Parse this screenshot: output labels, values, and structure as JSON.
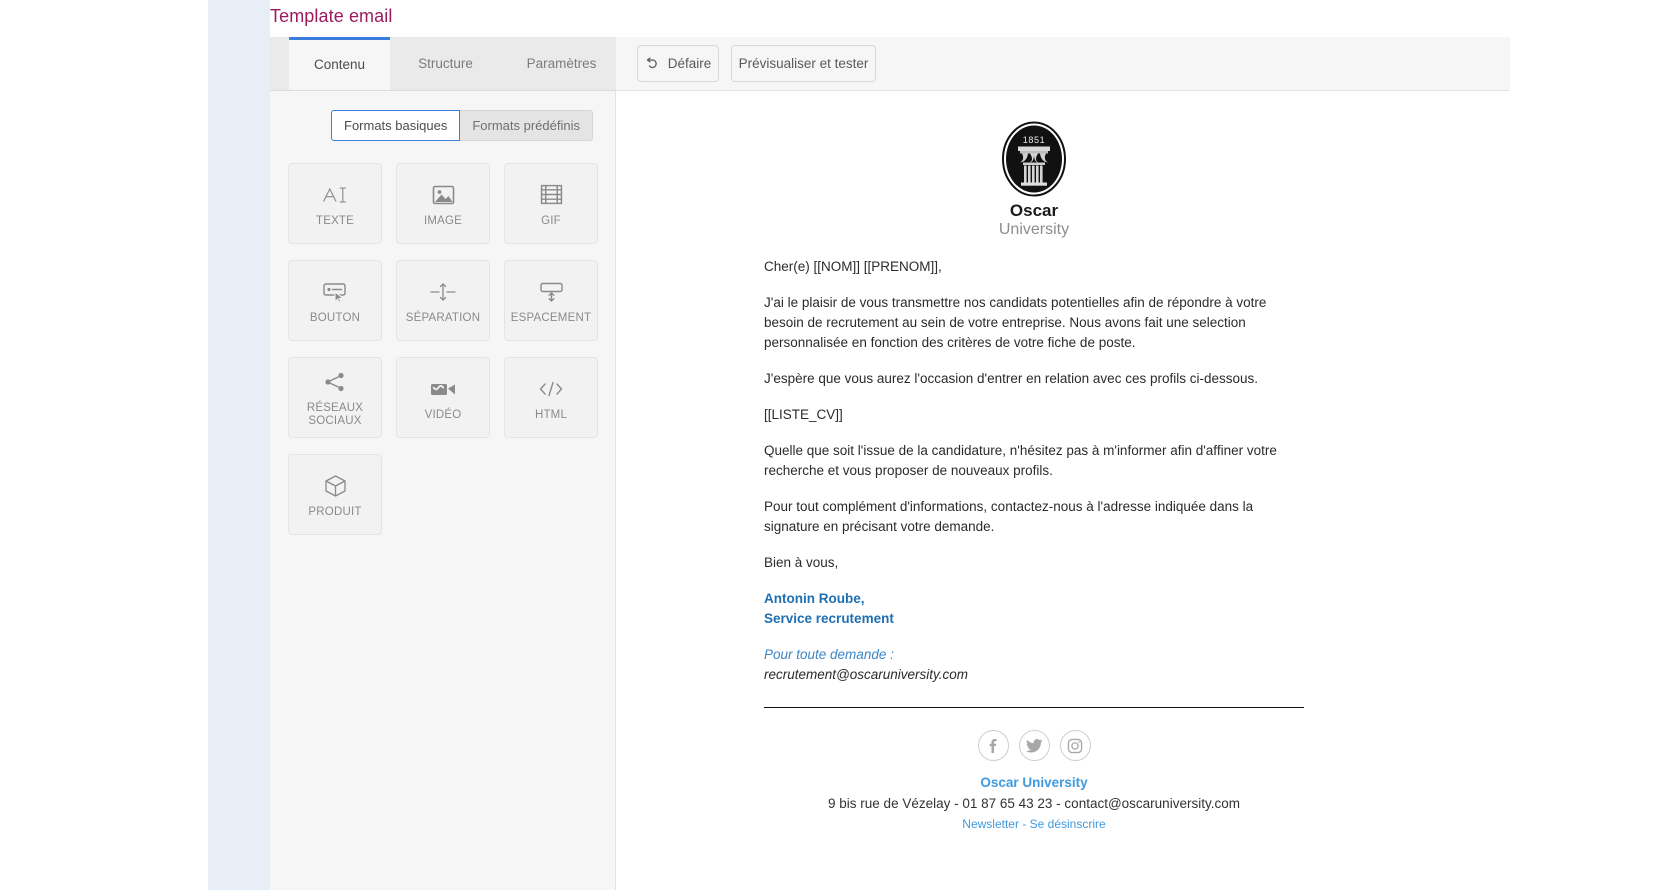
{
  "page": {
    "title": "Template email"
  },
  "tabs": [
    {
      "label": "Contenu",
      "active": true
    },
    {
      "label": "Structure",
      "active": false
    },
    {
      "label": "Paramètres",
      "active": false
    }
  ],
  "toolbar": {
    "undo_label": "Défaire",
    "undo_icon": "undo-arrow-icon",
    "preview_label": "Prévisualiser et tester"
  },
  "format_switch": {
    "basic_label": "Formats basiques",
    "preset_label": "Formats prédéfinis",
    "selected": "Formats basiques"
  },
  "blocks": [
    {
      "label": "TEXTE",
      "icon": "text-icon"
    },
    {
      "label": "IMAGE",
      "icon": "image-icon"
    },
    {
      "label": "GIF",
      "icon": "gif-icon"
    },
    {
      "label": "BOUTON",
      "icon": "button-icon"
    },
    {
      "label": "SÉPARATION",
      "icon": "separator-icon"
    },
    {
      "label": "ESPACEMENT",
      "icon": "spacing-icon"
    },
    {
      "label": "RÉSEAUX SOCIAUX",
      "icon": "share-icon"
    },
    {
      "label": "VIDÉO",
      "icon": "video-icon"
    },
    {
      "label": "HTML",
      "icon": "code-icon"
    },
    {
      "label": "PRODUIT",
      "icon": "cube-icon"
    }
  ],
  "email": {
    "logo": {
      "year": "1851",
      "name": "Oscar",
      "sub": "University"
    },
    "paragraphs": [
      "Cher(e) [[NOM]] [[PRENOM]],",
      "J'ai le plaisir de vous transmettre nos candidats potentielles afin de répondre à votre besoin de recrutement au sein de votre entreprise. Nous avons fait une selection personnalisée en fonction des critères de votre fiche de poste.",
      "J'espère que vous aurez l'occasion d'entrer en relation avec ces profils ci-dessous.",
      "[[LISTE_CV]]",
      "Quelle que soit l'issue de la candidature, n'hésitez pas à m'informer afin d'affiner votre recherche et vous proposer de nouveaux profils.",
      "Pour tout complément d'informations, contactez-nous à l'adresse indiquée dans la signature en précisant votre demande.",
      "Bien à vous,"
    ],
    "signature": {
      "line1": "Antonin Roube,",
      "line2": "Service recrutement"
    },
    "contact": {
      "lead": "Pour toute demande :",
      "email": "recrutement@oscaruniversity.com"
    },
    "socials": [
      {
        "name": "facebook-icon"
      },
      {
        "name": "twitter-icon"
      },
      {
        "name": "instagram-icon"
      }
    ],
    "footer": {
      "org": "Oscar University",
      "address": "9 bis rue de Vézelay - 01 87 65 43 23 - contact@oscaruniversity.com",
      "newsletter_link": "Newsletter",
      "separator": " - ",
      "unsubscribe_link": "Se désinscrire"
    }
  },
  "colors": {
    "title": "#9b1b5e",
    "tab_accent": "#3b7ddd",
    "signature_blue": "#1f6fb2",
    "contact_blue": "#3d85c6",
    "footer_blue": "#3f9ae0"
  }
}
